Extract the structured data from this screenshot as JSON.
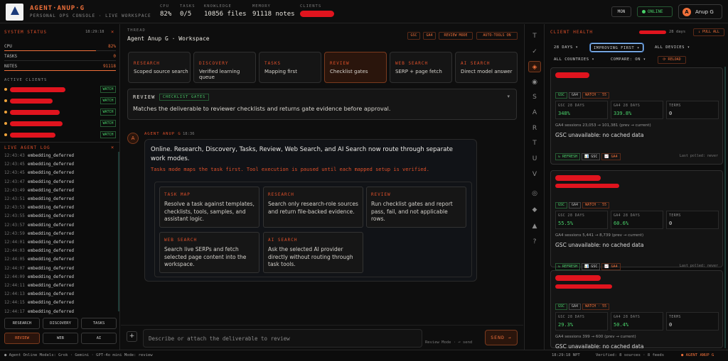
{
  "topbar": {
    "brand": "AGENT·ANUP·G",
    "subtitle": "PERSONAL OPS CONSOLE · LIVE WORKSPACE",
    "stats": [
      {
        "label": "CPU",
        "value": "82%"
      },
      {
        "label": "TASKS",
        "value": "0/5"
      },
      {
        "label": "KNOWLEDGE",
        "value": "10856 files"
      },
      {
        "label": "MEMORY",
        "value": "91118 notes"
      },
      {
        "label": "CLIENTS",
        "value": ""
      }
    ],
    "mon_label": "MON",
    "online_label": "ONLINE",
    "user_initial": "A",
    "user_name": "Anup G"
  },
  "left": {
    "system_status": "SYSTEM STATUS",
    "system_time": "18:29:18",
    "system_close": "×",
    "sys": [
      {
        "label": "CPU",
        "value": "82%",
        "pct": 82
      },
      {
        "label": "TASKS",
        "value": "0",
        "pct": 0
      },
      {
        "label": "NOTES",
        "value": "91118",
        "pct": 100
      }
    ],
    "active_clients": "ACTIVE CLIENTS",
    "watch_label": "WATCH",
    "client_count": 5,
    "log_title": "LIVE AGENT LOG",
    "log_close": "×",
    "log": [
      {
        "t": "12:43:43",
        "msg": "embedding_deferred"
      },
      {
        "t": "12:43:45",
        "msg": "embedding_deferred"
      },
      {
        "t": "12:43:45",
        "msg": "embedding_deferred"
      },
      {
        "t": "12:43:47",
        "msg": "embedding_deferred"
      },
      {
        "t": "12:43:49",
        "msg": "embedding_deferred"
      },
      {
        "t": "12:43:51",
        "msg": "embedding_deferred"
      },
      {
        "t": "12:43:53",
        "msg": "embedding_deferred"
      },
      {
        "t": "12:43:55",
        "msg": "embedding_deferred"
      },
      {
        "t": "12:43:57",
        "msg": "embedding_deferred"
      },
      {
        "t": "12:43:59",
        "msg": "embedding_deferred"
      },
      {
        "t": "12:44:01",
        "msg": "embedding_deferred"
      },
      {
        "t": "12:44:03",
        "msg": "embedding_deferred"
      },
      {
        "t": "12:44:05",
        "msg": "embedding_deferred"
      },
      {
        "t": "12:44:07",
        "msg": "embedding_deferred"
      },
      {
        "t": "12:44:09",
        "msg": "embedding_deferred"
      },
      {
        "t": "12:44:11",
        "msg": "embedding_deferred"
      },
      {
        "t": "12:44:13",
        "msg": "embedding_deferred"
      },
      {
        "t": "12:44:15",
        "msg": "embedding_deferred"
      },
      {
        "t": "12:44:17",
        "msg": "embedding_deferred"
      }
    ],
    "quick": [
      "RESEARCH",
      "DISCOVERY",
      "TASKS",
      "REVIEW",
      "WEB",
      "AI"
    ]
  },
  "main": {
    "thread_label": "THREAD",
    "thread_title": "Agent Anup G · Workspace",
    "toolbar": [
      "GSC",
      "GA4",
      "REVIEW MODE",
      "AUTO-TOOLS ON"
    ],
    "cards": [
      {
        "title": "RESEARCH",
        "desc": "Scoped source search"
      },
      {
        "title": "DISCOVERY",
        "desc": "Verified learning queue"
      },
      {
        "title": "TASKS",
        "desc": "Mapping first"
      },
      {
        "title": "REVIEW",
        "desc": "Checklist gates"
      },
      {
        "title": "WEB SEARCH",
        "desc": "SERP + page fetch"
      },
      {
        "title": "AI SEARCH",
        "desc": "Direct model answer"
      }
    ],
    "review": {
      "title": "REVIEW",
      "badge": "CHECKLIST GATES",
      "caret": "▾",
      "desc": "Matches the deliverable to reviewer checklists and returns gate evidence before approval."
    },
    "message": {
      "avatar": "A",
      "author": "AGENT ANUP G",
      "time": "18:36",
      "text": "Online. Research, Discovery, Tasks, Review, Web Search, and AI Search now route through separate work modes.",
      "note": "Tasks mode maps the task first. Tool execution is paused until each mapped setup is verified.",
      "modes": [
        {
          "title": "TASK MAP",
          "desc": "Resolve a task against templates, checklists, tools, samples, and assistant logic."
        },
        {
          "title": "RESEARCH",
          "desc": "Search only research-role sources and return file-backed evidence."
        },
        {
          "title": "REVIEW",
          "desc": "Run checklist gates and report pass, fail, and not applicable rows."
        },
        {
          "title": "WEB SEARCH",
          "desc": "Search live SERPs and fetch selected page content into the workspace."
        },
        {
          "title": "AI SEARCH",
          "desc": "Ask the selected AI provider directly without routing through task tools."
        }
      ]
    },
    "input": {
      "plus": "+",
      "placeholder": "Describe or attach the deliverable to review",
      "mode_hint": "Review Mode · ⏎ send",
      "send": "SEND →"
    }
  },
  "rail": [
    "T",
    "✓",
    "◈",
    "◉",
    "S",
    "A",
    "R",
    "T",
    "U",
    "V",
    "◎",
    "◆",
    "▲",
    "?"
  ],
  "right": {
    "title": "CLIENT HEALTH",
    "days": "28 days",
    "pull_all": "↓ PULL ALL",
    "filters": {
      "range": "28 DAYS ▾",
      "sort": "IMPROVING FIRST ▾",
      "devices": "ALL DEVICES ▾",
      "countries": "ALL COUNTRIES ▾",
      "compare": "COMPARE: ON ▾",
      "reload": "⟳ RELOAD"
    },
    "tags": [
      "GSC",
      "GA4",
      "WATCH · 55"
    ],
    "metric_labels": [
      "GSC 28 DAYS",
      "GA4 28 DAYS",
      "TERMS"
    ],
    "gsc_unavailable": "GSC unavailable: no cached data",
    "actions": [
      "↻ REFRESH",
      "📊 GSC",
      "📈 GA4"
    ],
    "last_polled": "Last polled: never",
    "clients": [
      {
        "gsc": "348%",
        "ga4": "339.8%",
        "terms": "0",
        "sessions": "GA4 sessions 23,053 → 101,381 (prev → current)"
      },
      {
        "gsc": "55.5%",
        "ga4": "60.6%",
        "terms": "0",
        "sessions": "GA4 sessions 5,441 → 8,739 (prev → current)"
      },
      {
        "gsc": "29.3%",
        "ga4": "50.4%",
        "terms": "0",
        "sessions": "GA4 sessions 399 → 600 (prev → current)"
      }
    ]
  },
  "status": {
    "left": "● Agent Online   Models: Grok · Gemini · GPT-4o mini   Mode: review",
    "time": "18:29:18 NPT",
    "verified": "Verified: 8 sources · 8 feeds",
    "right": "● AGENT ANUP G"
  },
  "colors": {
    "accent": "#f0703a",
    "green": "#49d26a",
    "redaction": "#e0141e"
  }
}
